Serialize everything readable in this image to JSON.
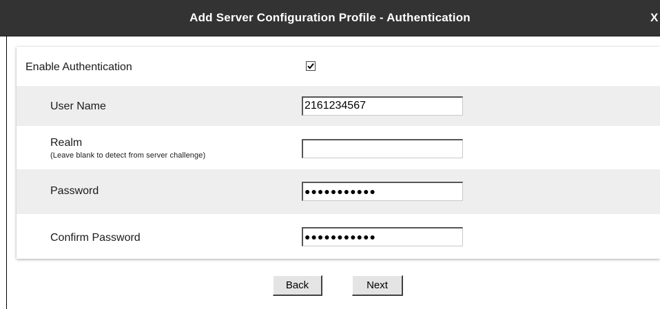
{
  "dialog": {
    "title": "Add Server Configuration Profile - Authentication",
    "close_label": "X"
  },
  "form": {
    "enable_authentication": {
      "label": "Enable Authentication",
      "checked": true
    },
    "user_name": {
      "label": "User Name",
      "value": "2161234567"
    },
    "realm": {
      "label": "Realm",
      "hint": "(Leave blank to detect from server challenge)",
      "value": ""
    },
    "password": {
      "label": "Password",
      "value": "●●●●●●●●●●●"
    },
    "confirm_password": {
      "label": "Confirm Password",
      "value": "●●●●●●●●●●●"
    }
  },
  "buttons": {
    "back_label": "Back",
    "next_label": "Next"
  },
  "colors": {
    "titlebar_bg": "#333333",
    "alt_row_bg": "#eeeeee",
    "button_bg": "#e4e4e4"
  }
}
